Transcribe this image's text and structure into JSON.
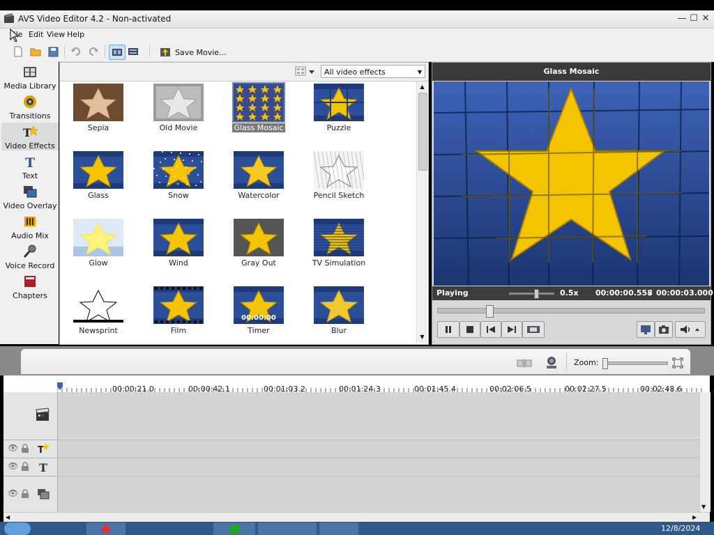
{
  "window": {
    "title": "AVS Video Editor 4.2 - Non-activated",
    "minimize": "—",
    "maximize": "☐",
    "close": "✕"
  },
  "menu": [
    "File",
    "Edit",
    "View",
    "Help"
  ],
  "toolbar": {
    "save_movie": "Save Movie..."
  },
  "sidebar": [
    {
      "label": "Media Library",
      "icon": "media-library-icon"
    },
    {
      "label": "Transitions",
      "icon": "transitions-icon"
    },
    {
      "label": "Video Effects",
      "icon": "video-effects-icon",
      "active": true
    },
    {
      "label": "Text",
      "icon": "text-icon"
    },
    {
      "label": "Video Overlay",
      "icon": "video-overlay-icon"
    },
    {
      "label": "Audio Mix",
      "icon": "audio-mix-icon"
    },
    {
      "label": "Voice Record",
      "icon": "voice-record-icon"
    },
    {
      "label": "Chapters",
      "icon": "chapters-icon"
    }
  ],
  "effects_filter": {
    "selected": "All video effects"
  },
  "effects": [
    {
      "label": "Sepia"
    },
    {
      "label": "Old Movie"
    },
    {
      "label": "Glass Mosaic",
      "selected": true
    },
    {
      "label": "Puzzle"
    },
    {
      "label": "Glass"
    },
    {
      "label": "Snow"
    },
    {
      "label": "Watercolor"
    },
    {
      "label": "Pencil Sketch"
    },
    {
      "label": "Glow"
    },
    {
      "label": "Wind"
    },
    {
      "label": "Gray Out"
    },
    {
      "label": "TV Simulation"
    },
    {
      "label": "Newsprint"
    },
    {
      "label": "Film"
    },
    {
      "label": "Timer",
      "overlay": "00:00:00"
    },
    {
      "label": "Blur"
    }
  ],
  "preview": {
    "title": "Glass Mosaic",
    "status": "Playing",
    "speed": "0.5x",
    "current_time": "00:00:00.558",
    "separator": "/",
    "total_time": "00:00:03.000",
    "progress": 0.18,
    "speed_level": 0.55
  },
  "timeline": {
    "zoom_label": "Zoom:",
    "ruler": [
      "00:00:21.0",
      "00:00:42.1",
      "00:01:03.2",
      "00:01:24.3",
      "00:01:45.4",
      "00:02:06.5",
      "00:02:27.5",
      "00:02:48.6"
    ]
  },
  "taskbar": {
    "date": "12/8/2024"
  },
  "colors": {
    "accent": "#3f5f9f",
    "star": "#f5c400",
    "tile": "#2b4f99"
  }
}
